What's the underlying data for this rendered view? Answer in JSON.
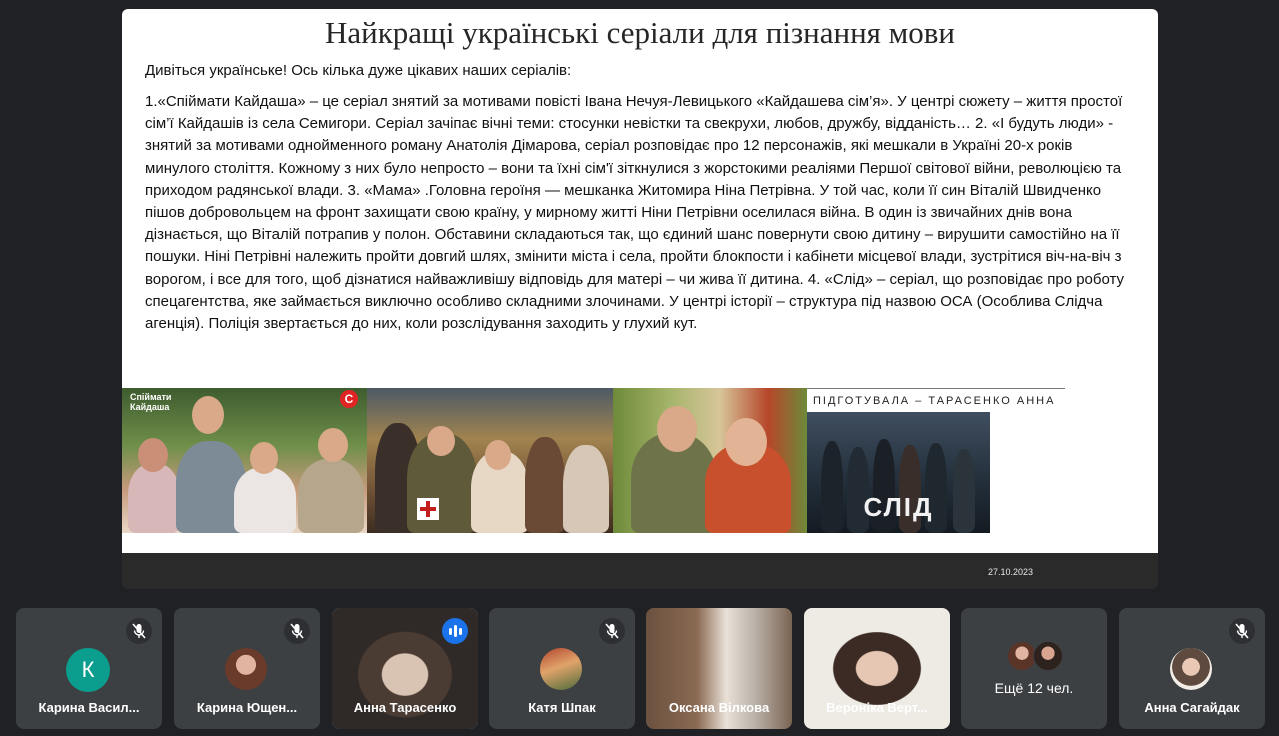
{
  "slide": {
    "title": "Найкращі українські серіали для пізнання мови",
    "intro": "Дивіться українське! Ось кілька дуже цікавих наших серіалів:",
    "body": "1.«Спіймати Кайдаша» – це серіал знятий за мотивами повісті Івана Нечуя-Левицького «Кайдашева сім’я». У центрі сюжету – життя простої сім’ї Кайдашів із села Семигори. Серіал зачіпає вічні теми: стосунки невістки та свекрухи, любов, дружбу, відданість… 2. «І будуть люди» - знятий за мотивами однойменного роману Анатолія Дімарова, серіал розповідає про 12 персонажів, які мешкали в Україні 20-х років минулого століття. Кожному з них було непросто – вони та їхні сім'ї зіткнулися з жорстокими реаліями Першої світової війни, революцією та приходом радянської влади. 3. «Мама» .Головна героїня — мешканка Житомира Ніна Петрівна. У той час, коли її син Віталій Швидченко пішов добровольцем на фронт захищати свою країну, у мирному житті Ніни Петрівни оселилася війна. В один із звичайних днів вона дізнається, що Віталій потрапив у полон. Обставини складаються так, що єдиний шанс повернути свою дитину – вирушити самостійно на її пошуки. Ніні Петрівні належить пройти довгий шлях, змінити міста і села, пройти блокпости і кабінети місцевої влади, зустрітися віч-на-віч з ворогом, і все для того, щоб дізнатися найважливішу відповідь для матері – чи жива її дитина. 4. «Слід» – серіал, що  розповідає про роботу спецагентства, яке займається виключно особливо складними злочинами. У центрі історії – структура під назвою ОСА (Особлива Слідча агенція). Поліція звертається до них, коли розслідування заходить у глухий кут.",
    "prepared_by": "ПІДГОТУВАЛА – ТАРАСЕНКО АННА",
    "date": "27.10.2023",
    "posters": {
      "poster1_logo": "Спіймати Кайдаша",
      "poster1_channel": "С",
      "poster4_logo": "СЛІД"
    }
  },
  "participants": [
    {
      "name": "Карина Васил...",
      "avatar_letter": "К",
      "avatar_color": "#0b9d8e",
      "muted": true
    },
    {
      "name": "Карина Ющен...",
      "muted": true
    },
    {
      "name": "Анна Тарасенко",
      "speaking": true
    },
    {
      "name": "Катя Шпак",
      "muted": true
    },
    {
      "name": "Оксана Вілкова"
    },
    {
      "name": "Вероніка Верт..."
    },
    {
      "more_label": "Ещё 12 чел."
    },
    {
      "name": "Анна Сагайдак",
      "muted": true
    }
  ],
  "icons": {
    "mute": "mic-off-icon",
    "speaking": "audio-level-icon"
  }
}
